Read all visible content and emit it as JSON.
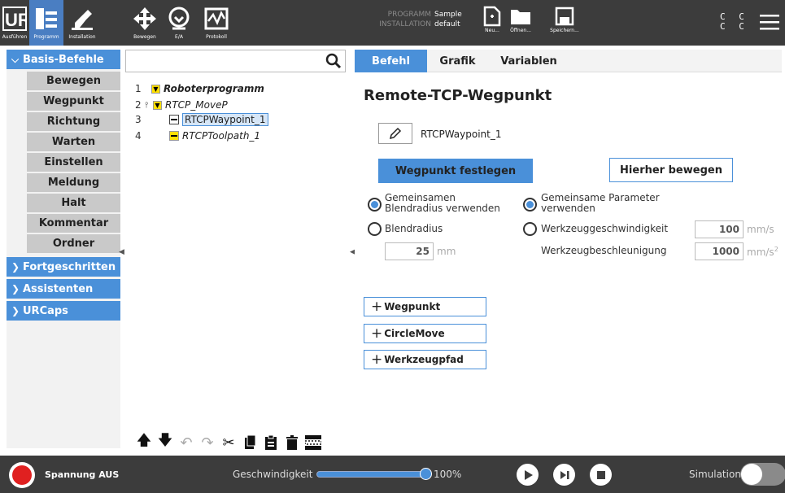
{
  "topbar": {
    "nav": [
      {
        "label": "Ausführen",
        "icon": "ur-logo-icon"
      },
      {
        "label": "Programm",
        "icon": "program-tree-icon"
      },
      {
        "label": "Installation",
        "icon": "installation-icon"
      },
      {
        "label": "Bewegen",
        "icon": "move-arrows-icon"
      },
      {
        "label": "E/A",
        "icon": "io-icon"
      },
      {
        "label": "Protokoll",
        "icon": "log-chart-icon"
      }
    ],
    "program_key": "PROGRAMM",
    "program_value": "Sample",
    "installation_key": "INSTALLATION",
    "installation_value": "default",
    "file_buttons": [
      {
        "label": "Neu...",
        "icon": "new-file-icon"
      },
      {
        "label": "Öffnen...",
        "icon": "folder-icon"
      },
      {
        "label": "Speichern...",
        "icon": "save-icon"
      }
    ],
    "cc_line1": "C C",
    "cc_line2": "C C"
  },
  "sidebar": {
    "sections": [
      {
        "label": "Basis-Befehle",
        "expanded": true
      },
      {
        "label": "Fortgeschritten",
        "expanded": false
      },
      {
        "label": "Assistenten",
        "expanded": false
      },
      {
        "label": "URCaps",
        "expanded": false
      }
    ],
    "items": [
      "Bewegen",
      "Wegpunkt",
      "Richtung",
      "Warten",
      "Einstellen",
      "Meldung",
      "Halt",
      "Kommentar",
      "Ordner"
    ]
  },
  "tree": {
    "search_value": "",
    "rows": [
      {
        "num": "1",
        "label": "Roboterprogramm"
      },
      {
        "num": "2",
        "label": "RTCP_MoveP"
      },
      {
        "num": "3",
        "label": "RTCPWaypoint_1"
      },
      {
        "num": "4",
        "label": "RTCPToolpath_1"
      }
    ]
  },
  "panel": {
    "tabs": [
      "Befehl",
      "Grafik",
      "Variablen"
    ],
    "active_tab": "Befehl",
    "title": "Remote-TCP-Wegpunkt",
    "waypoint_name": "RTCPWaypoint_1",
    "set_waypoint_label": "Wegpunkt festlegen",
    "move_here_label": "Hierher bewegen",
    "blend_shared_line1": "Gemeinsamen",
    "blend_shared_line2": "Blendradius verwenden",
    "blend_radius_label": "Blendradius",
    "blend_radius_value": "25",
    "blend_radius_unit": "mm",
    "params_shared_line1": "Gemeinsame Parameter",
    "params_shared_line2": "verwenden",
    "tool_speed_label": "Werkzeuggeschwindigkeit",
    "tool_speed_value": "100",
    "tool_speed_unit": "mm/s",
    "tool_accel_label": "Werkzeugbeschleunigung",
    "tool_accel_value": "1000",
    "tool_accel_unit": "mm/s",
    "tool_accel_unit_sup": "2",
    "add_buttons": [
      "Wegpunkt",
      "CircleMove",
      "Werkzeugpfad"
    ]
  },
  "bottombar": {
    "power_label": "Spannung AUS",
    "speed_label": "Geschwindigkeit",
    "speed_value": "100%",
    "speed_fraction": 1.0,
    "simulation_label": "Simulation"
  },
  "colors": {
    "accent": "#4a90d9",
    "topbar": "#3c3c3c",
    "highlight_yellow": "#ffe000",
    "power_red": "#e02020"
  }
}
